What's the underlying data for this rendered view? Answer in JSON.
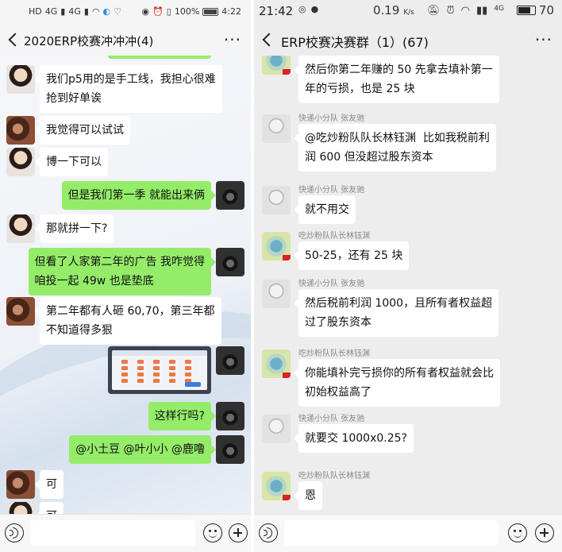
{
  "left": {
    "status": {
      "network_left": "HD",
      "signal_a": "4G",
      "signal_b": "4G",
      "battery_text": "100%",
      "time": "4:22"
    },
    "title": "2020ERP校赛冲冲冲(4)",
    "messages": [
      {
        "side": "left",
        "avatar": "girl",
        "text": "我们p5用的是手工线，我担心很难\n抢到好单诶"
      },
      {
        "side": "left",
        "avatar": "dark",
        "text": "我觉得可以试试"
      },
      {
        "side": "left",
        "avatar": "girl",
        "text": "博一下可以"
      },
      {
        "side": "right",
        "avatar": "cam",
        "text": "但是我们第一季 就能出来俩"
      },
      {
        "side": "left",
        "avatar": "girl",
        "text": "那就拼一下?"
      },
      {
        "side": "right",
        "avatar": "cam",
        "text": "但看了人家第二年的广告 我咋觉得\n咱投一起 49w 也是垫底"
      },
      {
        "side": "left",
        "avatar": "dark",
        "text": "第二年都有人砸 60,70，第三年都\n不知道得多狠"
      },
      {
        "side": "right",
        "avatar": "cam",
        "text": "这样行吗?"
      },
      {
        "side": "right",
        "avatar": "cam",
        "text": "@小土豆 @叶小小 @鹿噜"
      },
      {
        "side": "left",
        "avatar": "dark",
        "text": "可"
      },
      {
        "side": "left",
        "avatar": "girl",
        "text": "可"
      }
    ]
  },
  "right": {
    "status": {
      "time": "21:42",
      "speed": "0.19",
      "speed_unit": "K/s",
      "net": "4G",
      "battery": "70"
    },
    "title": "ERP校赛决赛群（1）(67)",
    "messages": [
      {
        "sender": "吃炒粉队队长林钰渊",
        "avatar": "lime",
        "text": "然后你第二年赚的 50 先拿去填补第一\n年的亏损，也是 25 块"
      },
      {
        "sender": "快递小分队 张友驰",
        "avatar": "sketch",
        "text": "@吃炒粉队队长林钰渊  比如我税前利\n润 600 但没超过股东资本"
      },
      {
        "sender": "快递小分队 张友驰",
        "avatar": "sketch",
        "text": "就不用交"
      },
      {
        "sender": "吃炒粉队队长林钰渊",
        "avatar": "lime",
        "text": "50-25，还有 25 块"
      },
      {
        "sender": "快递小分队 张友驰",
        "avatar": "sketch",
        "text": "然后税前利润 1000，且所有者权益超\n过了股东资本"
      },
      {
        "sender": "吃炒粉队队长林钰渊",
        "avatar": "lime",
        "text": "你能填补完亏损你的所有者权益就会比\n初始权益高了"
      },
      {
        "sender": "快递小分队 张友驰",
        "avatar": "sketch",
        "text": "就要交 1000x0.25?"
      },
      {
        "sender": "吃炒粉队队长林钰渊",
        "avatar": "lime",
        "text": "恩"
      }
    ]
  }
}
